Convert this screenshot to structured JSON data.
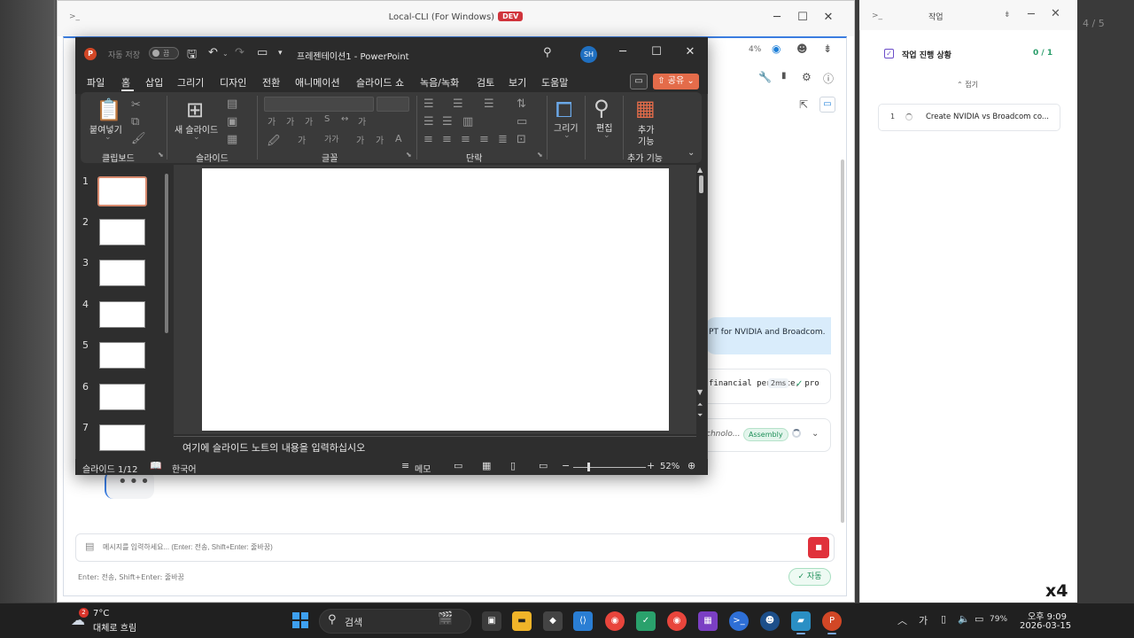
{
  "desktop": {
    "right_edge_text": "4 / 5"
  },
  "cli_window": {
    "title": "Local-CLI (For Windows)",
    "badge": "DEV",
    "controls": {
      "minimize": "─",
      "maximize": "☐",
      "close": "✕"
    },
    "toolbar": {
      "zoom": "4%"
    },
    "chat": {
      "user_message": "PT for NVIDIA and Broadcom.",
      "code_snippet": "financial per   ance, pro",
      "timing": "2ms",
      "tool_desc": "chnolo...",
      "tool_badge": "Assembly",
      "typing": "•••"
    },
    "input": {
      "placeholder": "메시지를 입력하세요... (Enter: 전송, Shift+Enter: 줄바꿈)",
      "hint": "Enter: 전송, Shift+Enter: 줄바꿈",
      "stop_label": "■",
      "auto_label": "자동"
    }
  },
  "task_panel": {
    "title": "작업",
    "progress_title": "작업 진행 상황",
    "progress_count": "0 / 1",
    "collapse_label": "접기",
    "items": [
      {
        "num": "1",
        "text": "Create NVIDIA vs Broadcom co..."
      }
    ]
  },
  "powerpoint": {
    "autosave_label": "자동 저장",
    "autosave_state": "끔",
    "filename": "프레젠테이션1 - PowerPoint",
    "avatar": "SH",
    "tabs": [
      "파일",
      "홈",
      "삽입",
      "그리기",
      "디자인",
      "전환",
      "애니메이션",
      "슬라이드 쇼",
      "녹음/녹화",
      "검토",
      "보기",
      "도움말"
    ],
    "share_label": "공유",
    "ribbon": {
      "paste": "붙여넣기",
      "new_slide": "새 슬라이드",
      "draw": "그리기",
      "edit": "편집",
      "addins_line1": "추가",
      "addins_line2": "기능",
      "group_clipboard": "클립보드",
      "group_slides": "슬라이드",
      "group_font": "글꼴",
      "group_paragraph": "단락",
      "group_addins": "추가 기능"
    },
    "slide_numbers": [
      "1",
      "2",
      "3",
      "4",
      "5",
      "6",
      "7"
    ],
    "notes_placeholder": "여기에 슬라이드 노트의 내용을 입력하십시오",
    "status": {
      "slide_pos": "슬라이드 1/12",
      "language": "한국어",
      "notes_btn": "메모",
      "zoom": "52%"
    }
  },
  "speed_indicator": "x4",
  "taskbar": {
    "weather_badge": "2",
    "temperature": "7°C",
    "weather_desc": "대체로 흐림",
    "search_label": "검색",
    "ime": "가",
    "battery": "79%",
    "time": "오후 9:09",
    "date": "2026-03-15"
  }
}
